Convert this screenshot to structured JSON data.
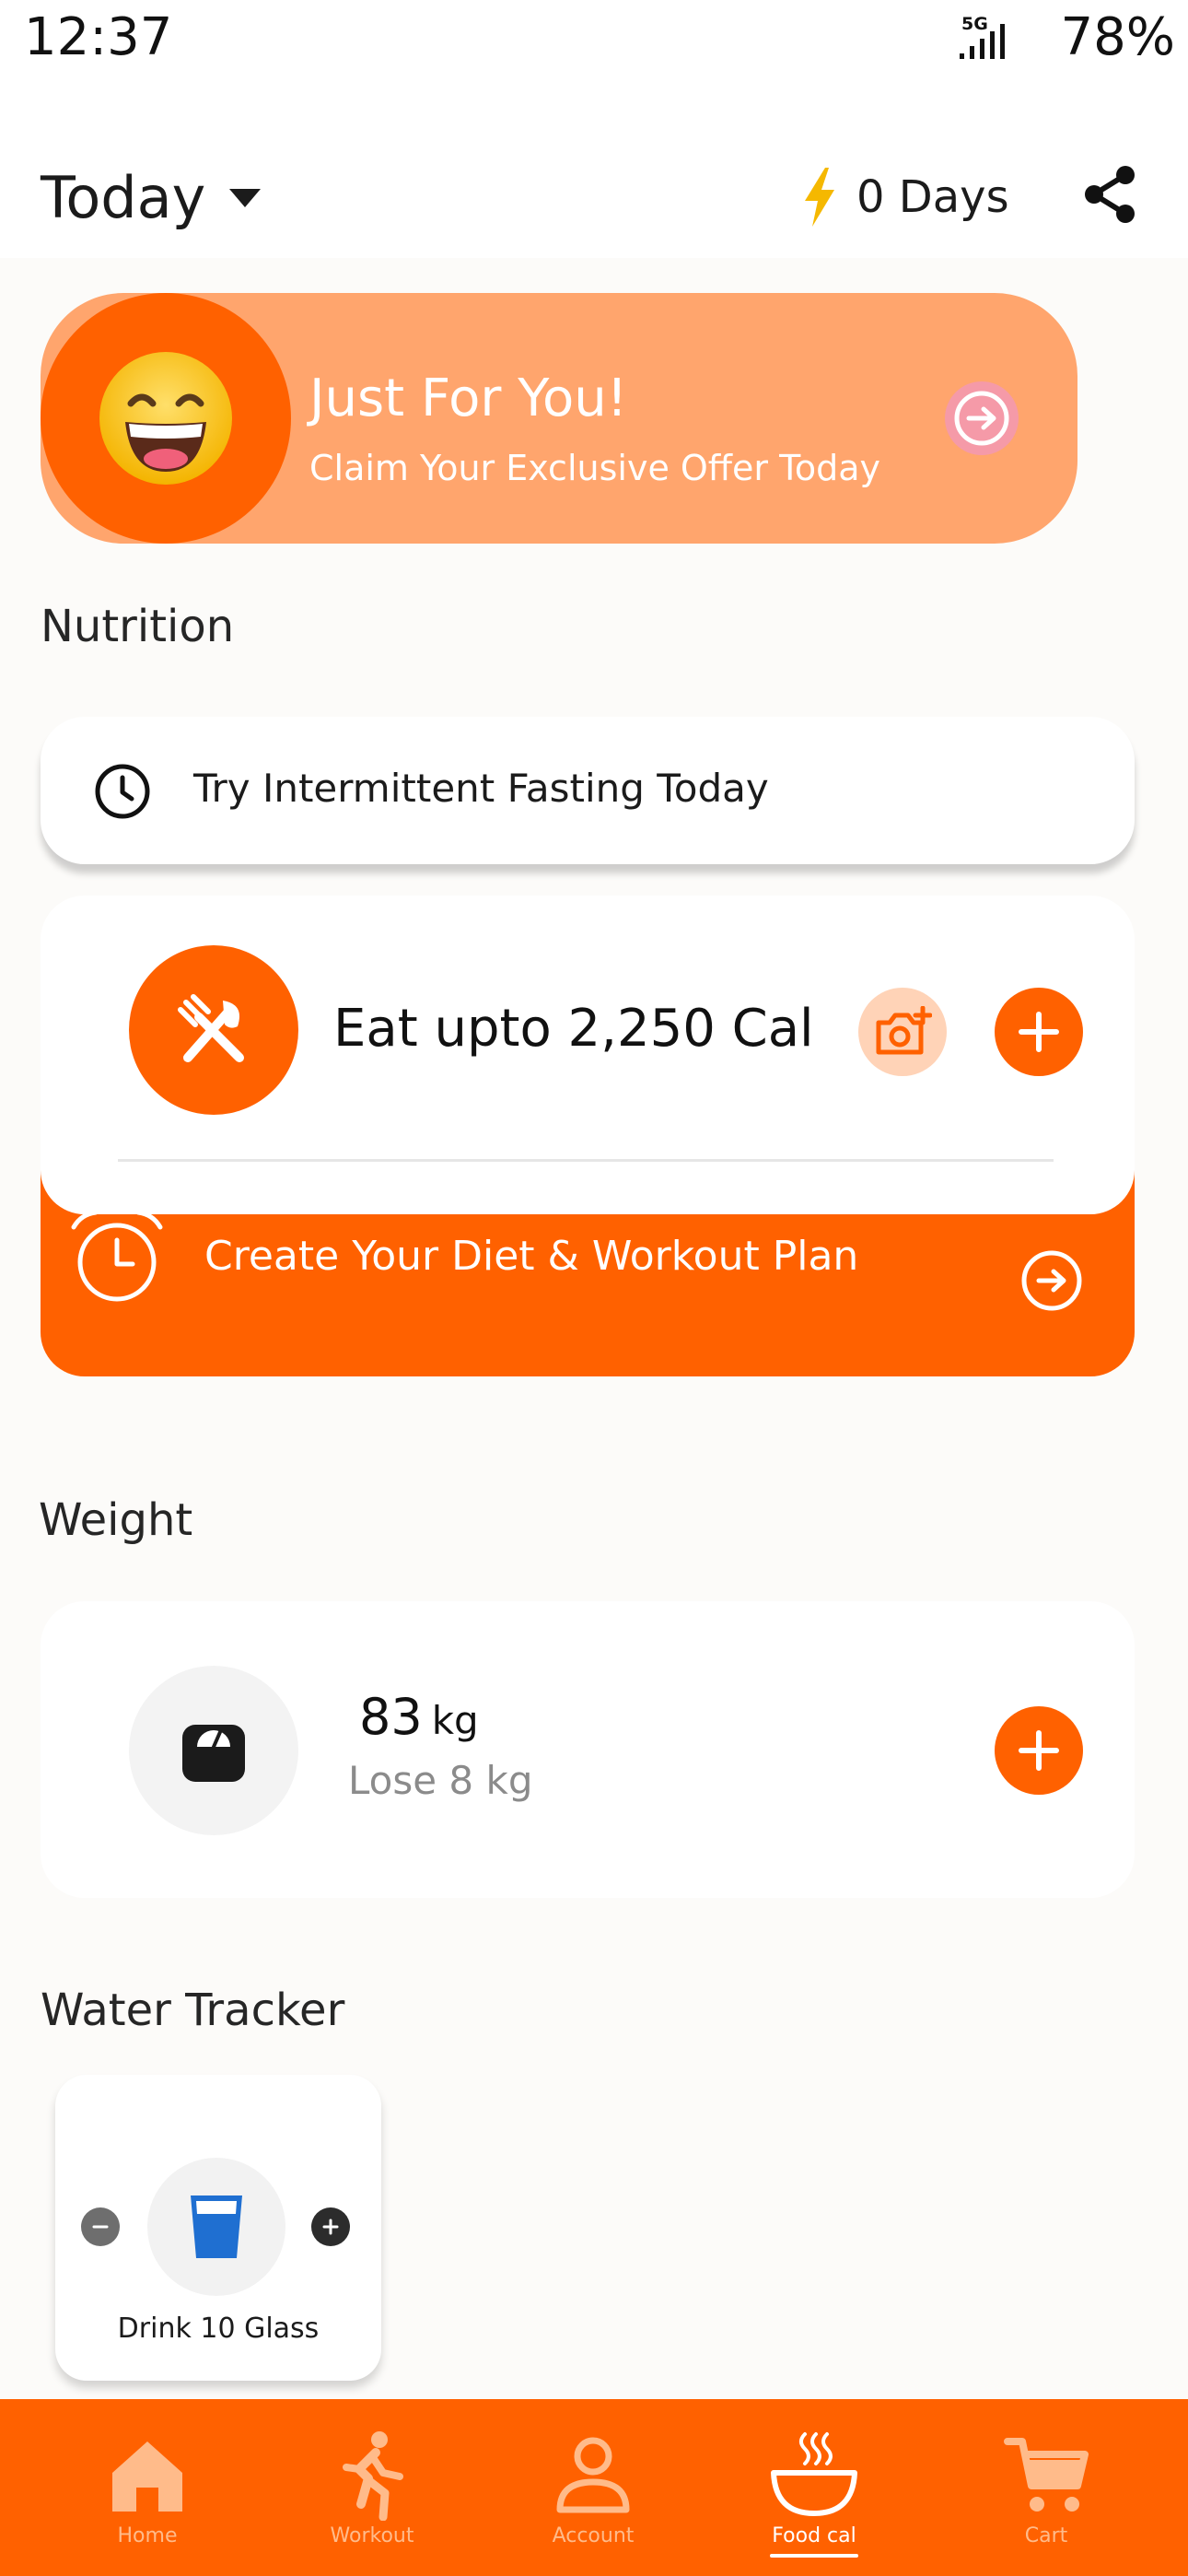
{
  "status_bar": {
    "time": "12:37",
    "network": "5G",
    "battery": "78%"
  },
  "header": {
    "date_selector": "Today",
    "streak": "0 Days"
  },
  "offer": {
    "title": "Just For You!",
    "subtitle": "Claim Your Exclusive Offer Today"
  },
  "nutrition": {
    "section_title": "Nutrition",
    "fasting_label": "Try Intermittent Fasting Today",
    "calorie_label": "Eat upto 2,250 Cal",
    "plan_label": "Create Your Diet & Workout Plan"
  },
  "weight": {
    "section_title": "Weight",
    "value": "83",
    "unit": "kg",
    "goal": "Lose 8 kg"
  },
  "water": {
    "section_title": "Water Tracker",
    "label": "Drink 10 Glass"
  },
  "bottom_nav": {
    "items": [
      {
        "label": "Home",
        "icon": "home-icon"
      },
      {
        "label": "Workout",
        "icon": "running-icon"
      },
      {
        "label": "Account",
        "icon": "person-icon"
      },
      {
        "label": "Food cal",
        "icon": "food-bowl-icon",
        "active": true
      },
      {
        "label": "Cart",
        "icon": "cart-icon"
      }
    ]
  },
  "colors": {
    "accent": "#ff6100",
    "banner": "#ffa56d",
    "nav_inactive": "#ffbb8a",
    "water_blue": "#1f6fd1",
    "streak_bolt": "#f5b800"
  }
}
